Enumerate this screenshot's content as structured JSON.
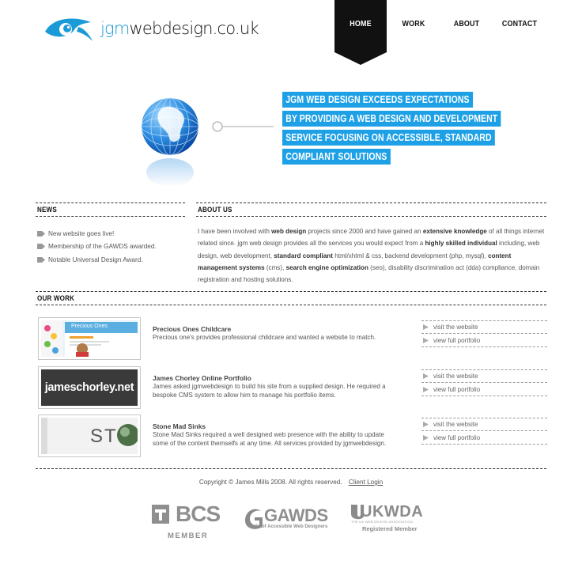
{
  "header": {
    "logo_jgm": "jgm",
    "logo_rest": "webdesign.co.uk",
    "accent": "#1a9bd7"
  },
  "nav": {
    "home": "HOME",
    "work": "WORK",
    "about": "ABOUT",
    "contact": "CONTACT"
  },
  "hero": {
    "lines": [
      "JGM WEB DESIGN EXCEEDS EXPECTATIONS",
      "BY PROVIDING A WEB DESIGN AND DEVELOPMENT",
      "SERVICE FOCUSING ON ACCESSIBLE, STANDARD",
      "COMPLIANT SOLUTIONS"
    ],
    "highlight_color": "#1ea0e6"
  },
  "news": {
    "title": "NEWS",
    "items": [
      "New website goes live!",
      "Membership of the GAWDS awarded.",
      "Notable Universal Design Award."
    ]
  },
  "about": {
    "title": "ABOUT US",
    "p1": "I have been involved with ",
    "b1": "web design",
    "p2": " projects since 2000 and have gained an ",
    "b2": "extensive knowledge",
    "p3": " of all things internet related since. jgm web design provides all the services you would expect from a ",
    "b3": "highly skilled individual",
    "p4": " including, web design, web development, ",
    "b4": "standard compliant",
    "p5": " html/xhtml & css, backend development (php, mysql), ",
    "b5": "content management systems",
    "p6": " (cms), ",
    "b6": "search engine optimization",
    "p7": " (seo), disability discrimination act (dda) compliance, domain registration and hosting solutions."
  },
  "work": {
    "title": "OUR WORK",
    "items": [
      {
        "title": "Precious Ones Childcare",
        "desc": "Precious one's provides professional childcare and wanted a website to match.",
        "thumb_text": "Precious Ones",
        "link1": "visit the website",
        "link2": "view full portfolio"
      },
      {
        "title": "James Chorley Online Portfolio",
        "desc": "James asked jgmwebdesign to build his site from a supplied design. He required a bespoke CMS system to allow him to manage his portfolio items.",
        "thumb_text": "jameschorley.net",
        "link1": "visit the website",
        "link2": "view full portfolio"
      },
      {
        "title": "Stone Mad Sinks",
        "desc": "Stone Mad Sinks required a well designed web presence with the ability to update some of the content themselfs at any time. All services provided by jgmwebdesign.",
        "thumb_text": "ST",
        "link1": "visit the website",
        "link2": "view full portfolio"
      }
    ]
  },
  "footer": {
    "copyright": "Copyright © James Mills 2008. All rights reserved.",
    "client_login": "Client Login",
    "badges": {
      "bcs": "BCS",
      "bcs_sub": "MEMBER",
      "gawds": "GAWDS",
      "gawds_sub": "Guild of Accessible Web Designers",
      "ukwda": "UKWDA",
      "ukwda_small": "THE UK WEB DESIGN ASSOCIATION",
      "ukwda_sub": "Registered Member"
    }
  }
}
